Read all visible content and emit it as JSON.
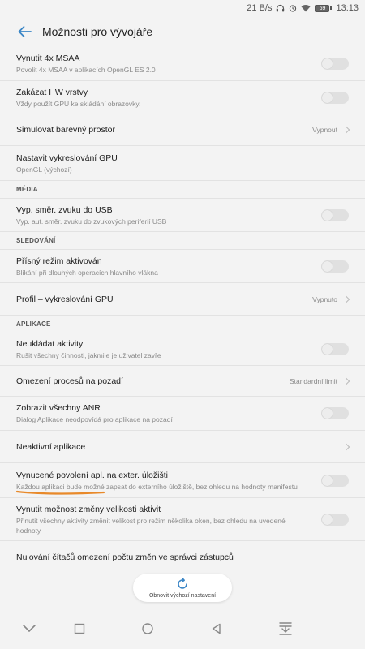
{
  "status": {
    "net_speed": "21 B/s",
    "battery": "69",
    "time": "13:13"
  },
  "header": {
    "title": "Možnosti pro vývojáře"
  },
  "rows": [
    {
      "title": "Vynutit 4x MSAA",
      "subtitle": "Povolit 4x MSAA v aplikacích OpenGL ES 2.0",
      "control": "toggle",
      "on": false
    },
    {
      "title": "Zakázat HW vrstvy",
      "subtitle": "Vždy použít GPU ke skládání obrazovky.",
      "control": "toggle",
      "on": false
    },
    {
      "title": "Simulovat barevný prostor",
      "value": "Vypnout",
      "control": "chevron"
    },
    {
      "title": "Nastavit vykreslování GPU",
      "subtitle": "OpenGL (výchozí)"
    },
    {
      "section": "MÉDIA"
    },
    {
      "title": "Vyp. směr. zvuku do USB",
      "subtitle": "Vyp. aut. směr. zvuku do zvukových periferií USB",
      "control": "toggle",
      "on": false
    },
    {
      "section": "SLEDOVÁNÍ"
    },
    {
      "title": "Přísný režim aktivován",
      "subtitle": "Blikání při dlouhých operacích hlavního vlákna",
      "control": "toggle",
      "on": false
    },
    {
      "title": "Profil – vykreslování GPU",
      "value": "Vypnuto",
      "control": "chevron"
    },
    {
      "section": "APLIKACE"
    },
    {
      "title": "Neukládat aktivity",
      "subtitle": "Rušit všechny činnosti, jakmile je uživatel zavře",
      "control": "toggle",
      "on": false
    },
    {
      "title": "Omezení procesů na pozadí",
      "value": "Standardní limit",
      "control": "chevron"
    },
    {
      "title": "Zobrazit všechny ANR",
      "subtitle": "Dialog Aplikace neodpovídá pro aplikace na pozadí",
      "control": "toggle",
      "on": false
    },
    {
      "title": "Neaktivní aplikace",
      "control": "chevron"
    },
    {
      "title": "Vynucené povolení apl. na exter. úložišti",
      "subtitle": "Každou aplikaci bude možné zapsat do externího úložiště, bez ohledu na hodnoty manifestu",
      "control": "toggle",
      "on": false
    },
    {
      "title": "Vynutit možnost změny velikosti aktivit",
      "subtitle": "Přinutit všechny aktivity změnit velikost pro režim několika oken, bez ohledu na uvedené hodnoty",
      "control": "toggle",
      "on": false
    },
    {
      "title": "Nulování čítačů omezení počtu změn ve správci zástupců"
    }
  ],
  "restore_button": {
    "label": "Obnovit výchozí nastavení"
  },
  "colors": {
    "accent": "#3b86c6",
    "annotation": "#e8892a"
  },
  "icons": [
    "back-arrow-icon",
    "headphones-icon",
    "alarm-icon",
    "wifi-icon",
    "battery-icon",
    "refresh-icon",
    "nav-down-icon",
    "nav-recents-icon",
    "nav-home-icon",
    "nav-back-icon",
    "nav-notifications-icon"
  ]
}
